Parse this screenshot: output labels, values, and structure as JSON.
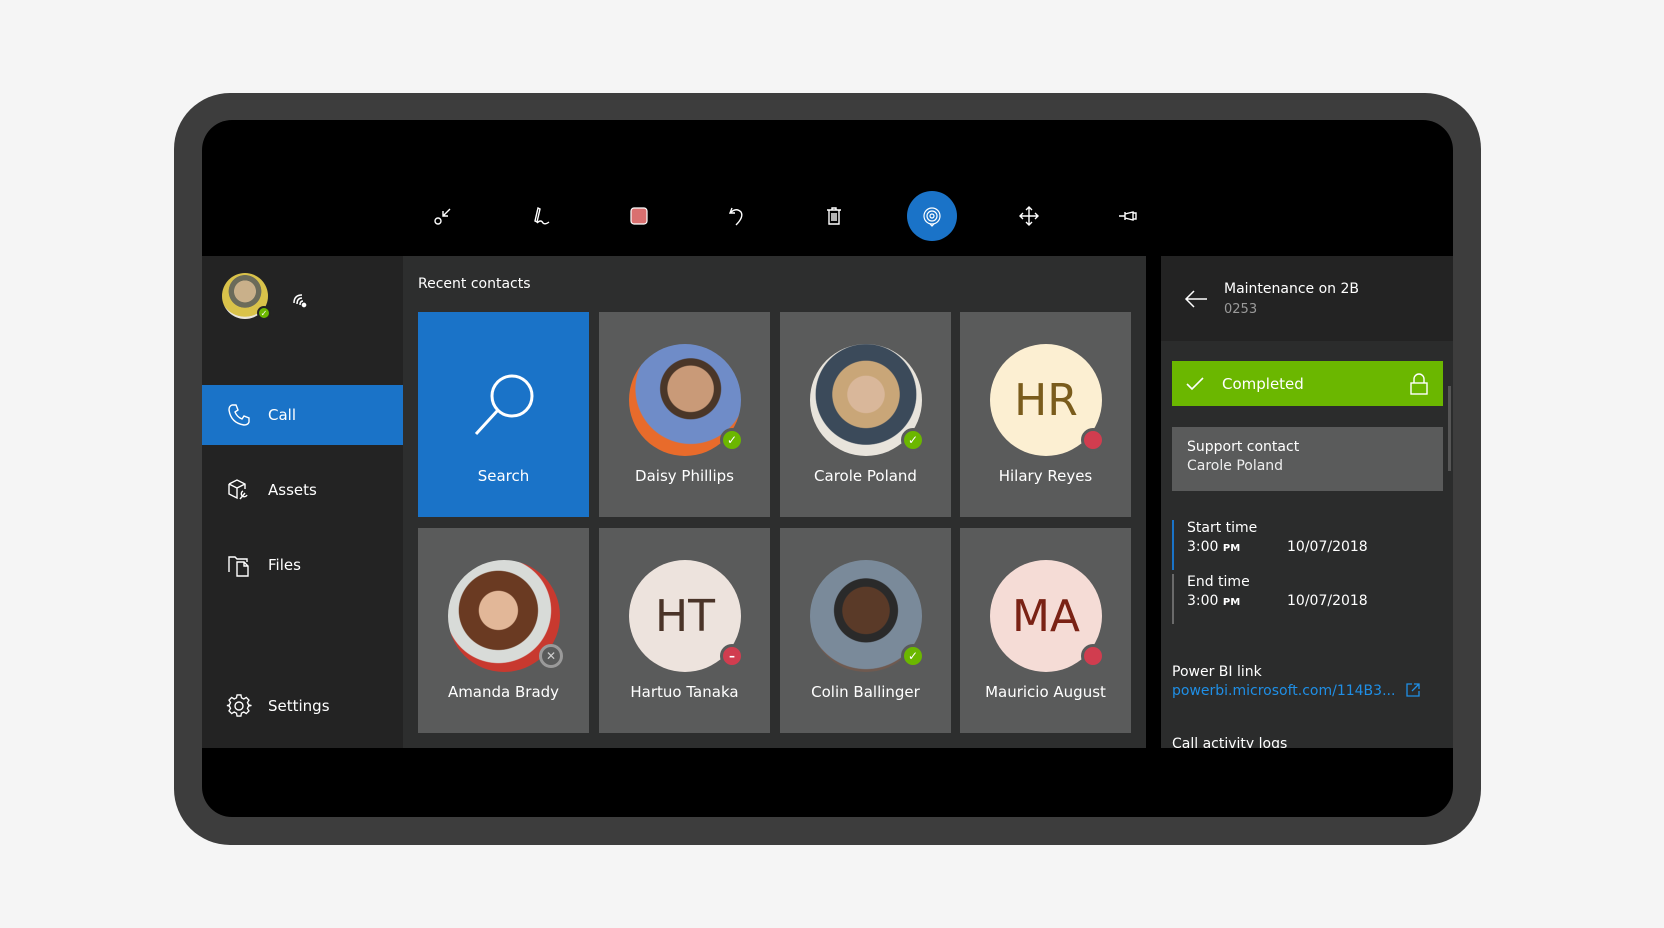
{
  "toolbar": {
    "tools": [
      {
        "name": "minimize-icon",
        "label": "Minimize"
      },
      {
        "name": "ink-pen-icon",
        "label": "Ink"
      },
      {
        "name": "color-swatch-icon",
        "label": "Color",
        "color": "#d97070"
      },
      {
        "name": "undo-icon",
        "label": "Undo"
      },
      {
        "name": "delete-icon",
        "label": "Delete"
      },
      {
        "name": "mixed-reality-capture-icon",
        "label": "Capture",
        "active": true
      },
      {
        "name": "move-icon",
        "label": "Move"
      },
      {
        "name": "pin-icon",
        "label": "Pin"
      }
    ]
  },
  "sidebar": {
    "user": {
      "presence": "available"
    },
    "items": [
      {
        "label": "Call",
        "icon": "phone-icon",
        "active": true
      },
      {
        "label": "Assets",
        "icon": "assets-icon"
      },
      {
        "label": "Files",
        "icon": "files-icon"
      },
      {
        "label": "Settings",
        "icon": "gear-icon"
      }
    ]
  },
  "main": {
    "title": "Recent contacts",
    "search_label": "Search",
    "contacts": [
      {
        "name": "Daisy Phillips",
        "initials": "",
        "photo": true,
        "presence": "available"
      },
      {
        "name": "Carole Poland",
        "initials": "",
        "photo": true,
        "presence": "available"
      },
      {
        "name": "Hilary Reyes",
        "initials": "HR",
        "photo": false,
        "presence": "busy",
        "bg": "#fcefd2",
        "fg": "#7a5c1c"
      },
      {
        "name": "Amanda Brady",
        "initials": "",
        "photo": true,
        "presence": "offline"
      },
      {
        "name": "Hartuo Tanaka",
        "initials": "HT",
        "photo": false,
        "presence": "do-not-disturb",
        "bg": "#ede3dd",
        "fg": "#4a3428"
      },
      {
        "name": "Colin Ballinger",
        "initials": "",
        "photo": true,
        "presence": "available"
      },
      {
        "name": "Mauricio August",
        "initials": "MA",
        "photo": false,
        "presence": "busy",
        "bg": "#f5dcd6",
        "fg": "#7a2215"
      }
    ]
  },
  "detail": {
    "title": "Maintenance on 2B",
    "subtitle": "0253",
    "status": "Completed",
    "status_color": "#6bb700",
    "support_label": "Support contact",
    "support_value": "Carole Poland",
    "start_label": "Start time",
    "start_time": "3:00",
    "start_ampm": "PM",
    "start_date": "10/07/2018",
    "end_label": "End time",
    "end_time": "3:00",
    "end_ampm": "PM",
    "end_date": "10/07/2018",
    "pbi_label": "Power BI link",
    "pbi_link": "powerbi.microsoft.com/114B3...",
    "call_logs_label": "Call activity logs"
  },
  "colors": {
    "accent": "#1a73c8",
    "success": "#6bb700",
    "busy": "#d13d4f",
    "link": "#1f8fe6"
  }
}
